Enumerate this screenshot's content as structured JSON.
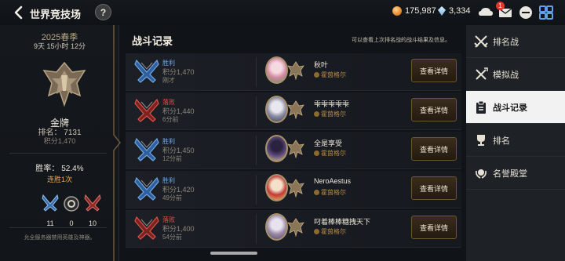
{
  "header": {
    "title": "世界竞技场",
    "help_label": "?",
    "gold": "175,987",
    "crystals": "3,334",
    "mail_badge": "1"
  },
  "left_panel": {
    "season": "2025春季",
    "time_left": "9天 15小时 12分",
    "rank_name": "金牌",
    "rank_no": "排名：  7131",
    "score": "积分1,470",
    "win_rate": "胜率：  52.4%",
    "streak": "连胜1次",
    "stats": [
      {
        "icon": "victory-crossed-swords",
        "value": "11"
      },
      {
        "icon": "draw-circle",
        "value": "0"
      },
      {
        "icon": "defeat-broken-swords",
        "value": "10"
      }
    ],
    "ban_notice": "允全服务器禁用英雄及神器。"
  },
  "main": {
    "title": "战斗记录",
    "hint": "可以查看上次排名战的战斗结果及信息。",
    "detail_label": "查看详情",
    "records": [
      {
        "result": "胜利",
        "win": true,
        "score": "积分1,470",
        "time": "刚才",
        "opponent": "秋叶",
        "guild": "霍茵格尔",
        "avatar_colors": [
          "#f4d9e0",
          "#d48aa3",
          "#6a8c5c"
        ]
      },
      {
        "result": "落败",
        "win": false,
        "score": "积分1,440",
        "time": "6分前",
        "opponent": "雫雫雫雫雫",
        "guild": "霍茵格尔",
        "avatar_colors": [
          "#e9e7ee",
          "#8a8aa3",
          "#3c3f58"
        ]
      },
      {
        "result": "胜利",
        "win": true,
        "score": "积分1,450",
        "time": "12分前",
        "opponent": "全是享受",
        "guild": "霍茵格尔",
        "avatar_colors": [
          "#2b2240",
          "#5c4a7a",
          "#d9c08a"
        ]
      },
      {
        "result": "胜利",
        "win": true,
        "score": "积分1,420",
        "time": "49分前",
        "opponent": "NeroAestus",
        "guild": "霍茵格尔",
        "avatar_colors": [
          "#f2e0c8",
          "#c23a3a",
          "#e8c25a"
        ]
      },
      {
        "result": "落败",
        "win": false,
        "score": "积分1,400",
        "time": "54分前",
        "opponent": "叼着棒棒糖拽天下",
        "guild": "霍茵格尔",
        "avatar_colors": [
          "#e8e2ee",
          "#9a8aa8",
          "#5a4a6a"
        ]
      }
    ]
  },
  "right_menu": {
    "items": [
      {
        "label": "排名战",
        "icon": "crossed-swords-icon",
        "active": false
      },
      {
        "label": "模拟战",
        "icon": "practice-swords-icon",
        "active": false
      },
      {
        "label": "战斗记录",
        "icon": "clipboard-icon",
        "active": true
      },
      {
        "label": "排名",
        "icon": "trophy-icon",
        "active": false
      },
      {
        "label": "名誉殿堂",
        "icon": "laurel-icon",
        "active": false
      }
    ]
  },
  "colors": {
    "win": "#6fa8e6",
    "loss": "#e0504a",
    "accent": "#f0a64a",
    "guild": "#b6893e"
  }
}
